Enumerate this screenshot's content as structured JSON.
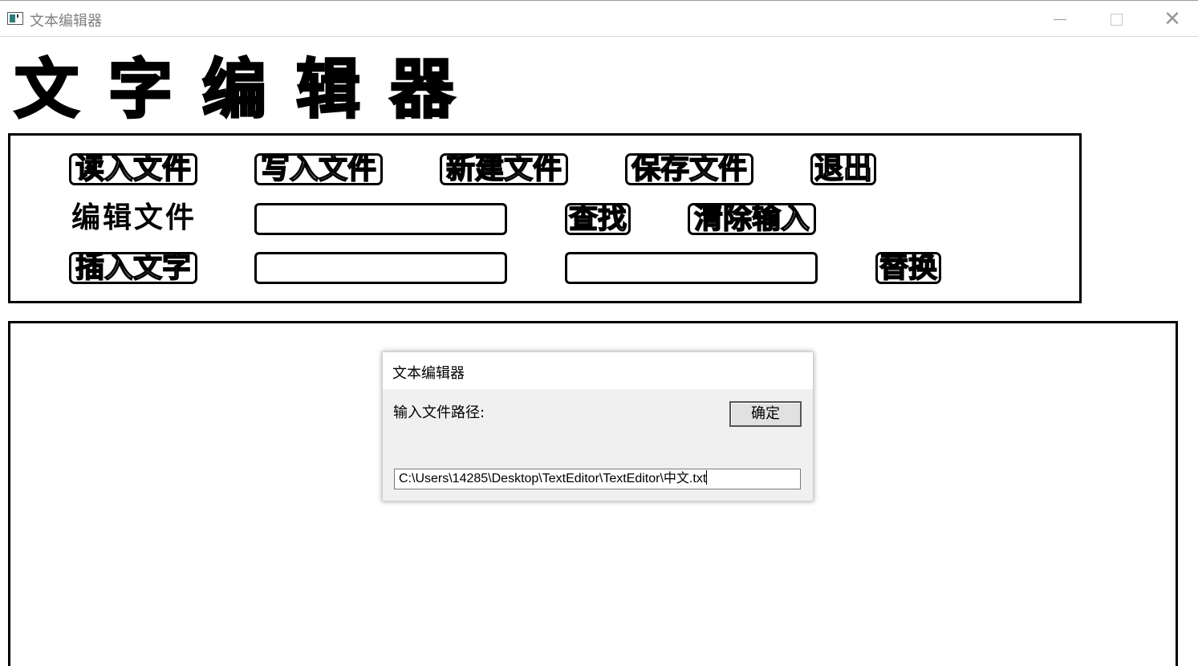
{
  "window": {
    "title": "文本编辑器",
    "minimize_icon": "minimize-icon",
    "maximize_icon": "maximize-icon",
    "close_icon": "close-icon",
    "close_glyph": "✕"
  },
  "header": {
    "title": "文字编辑器"
  },
  "panel": {
    "row1": {
      "read_file": "读入文件",
      "write_file": "写入文件",
      "new_file": "新建文件",
      "save_file": "保存文件",
      "exit": "退出"
    },
    "row2": {
      "label": "编辑文件",
      "search_value": "",
      "find_button": "查找",
      "clear_button": "清除输入"
    },
    "row3": {
      "insert_button": "插入文字",
      "insert_value": "",
      "replace_value": "",
      "replace_button": "替换"
    }
  },
  "dialog": {
    "title": "文本编辑器",
    "prompt": "输入文件路径:",
    "ok_button": "确定",
    "input_value": "C:\\Users\\14285\\Desktop\\TextEditor\\TextEditor\\中文.txt"
  }
}
